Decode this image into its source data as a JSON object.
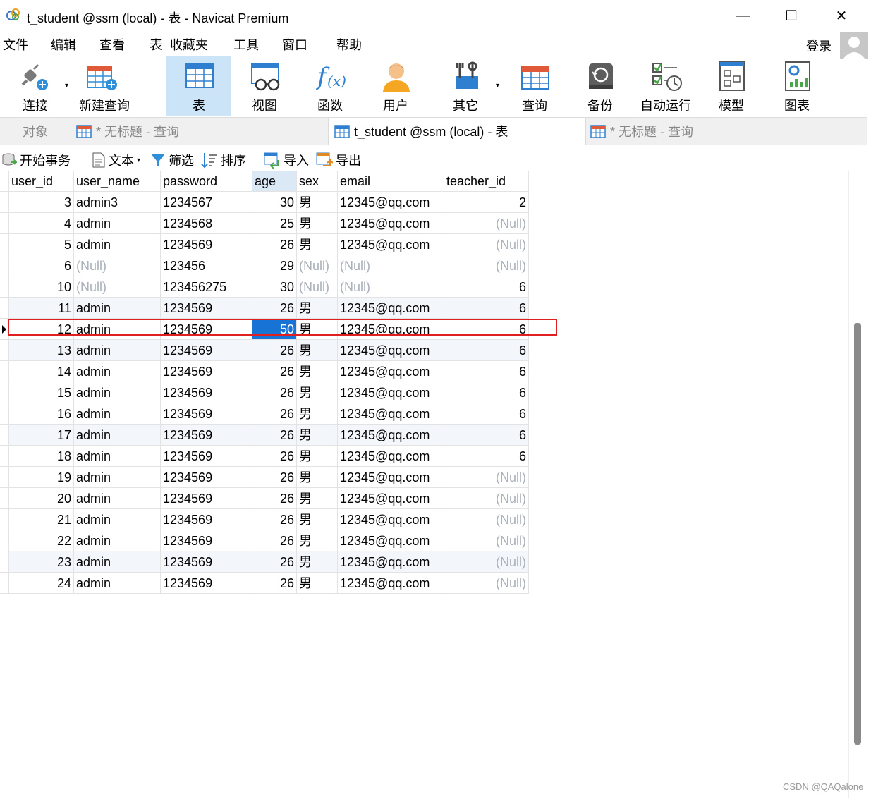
{
  "window": {
    "title": "t_student @ssm (local) - 表 - Navicat Premium",
    "minimize_glyph": "—",
    "maximize_glyph": "☐",
    "close_glyph": "✕"
  },
  "menu": {
    "items": [
      "文件",
      "编辑",
      "查看",
      "表",
      "收藏夹",
      "工具",
      "窗口",
      "帮助"
    ],
    "login": "登录"
  },
  "toolbar": {
    "buttons": [
      {
        "label": "连接",
        "icon": "plug-connect-icon"
      },
      {
        "label": "新建查询",
        "icon": "new-query-icon"
      },
      {
        "label": "表",
        "icon": "table-icon"
      },
      {
        "label": "视图",
        "icon": "view-glasses-icon"
      },
      {
        "label": "函数",
        "icon": "function-icon"
      },
      {
        "label": "用户",
        "icon": "user-icon"
      },
      {
        "label": "其它",
        "icon": "tools-icon"
      },
      {
        "label": "查询",
        "icon": "query-icon"
      },
      {
        "label": "备份",
        "icon": "backup-icon"
      },
      {
        "label": "自动运行",
        "icon": "auto-run-icon"
      },
      {
        "label": "模型",
        "icon": "model-icon"
      },
      {
        "label": "图表",
        "icon": "chart-icon"
      }
    ],
    "active": "表"
  },
  "tabs": [
    {
      "label": "对象"
    },
    {
      "label": "* 无标题 - 查询"
    },
    {
      "label": "t_student @ssm (local) - 表"
    },
    {
      "label": "* 无标题 - 查询"
    }
  ],
  "actions": {
    "begin_transaction": "开始事务",
    "text": "文本",
    "filter": "筛选",
    "sort": "排序",
    "import": "导入",
    "export": "导出"
  },
  "grid": {
    "columns": [
      "user_id",
      "user_name",
      "password",
      "age",
      "sex",
      "email",
      "teacher_id"
    ],
    "rows": [
      [
        "3",
        "admin3",
        "1234567",
        "30",
        "男",
        "12345@qq.com",
        "2"
      ],
      [
        "4",
        "admin",
        "1234568",
        "25",
        "男",
        "12345@qq.com",
        "(Null)"
      ],
      [
        "5",
        "admin",
        "1234569",
        "26",
        "男",
        "12345@qq.com",
        "(Null)"
      ],
      [
        "6",
        "(Null)",
        "123456",
        "29",
        "(Null)",
        "(Null)",
        "(Null)"
      ],
      [
        "10",
        "(Null)",
        "123456275",
        "30",
        "(Null)",
        "(Null)",
        "6"
      ],
      [
        "11",
        "admin",
        "1234569",
        "26",
        "男",
        "12345@qq.com",
        "6"
      ],
      [
        "12",
        "admin",
        "1234569",
        "50",
        "男",
        "12345@qq.com",
        "6"
      ],
      [
        "13",
        "admin",
        "1234569",
        "26",
        "男",
        "12345@qq.com",
        "6"
      ],
      [
        "14",
        "admin",
        "1234569",
        "26",
        "男",
        "12345@qq.com",
        "6"
      ],
      [
        "15",
        "admin",
        "1234569",
        "26",
        "男",
        "12345@qq.com",
        "6"
      ],
      [
        "16",
        "admin",
        "1234569",
        "26",
        "男",
        "12345@qq.com",
        "6"
      ],
      [
        "17",
        "admin",
        "1234569",
        "26",
        "男",
        "12345@qq.com",
        "6"
      ],
      [
        "18",
        "admin",
        "1234569",
        "26",
        "男",
        "12345@qq.com",
        "6"
      ],
      [
        "19",
        "admin",
        "1234569",
        "26",
        "男",
        "12345@qq.com",
        "(Null)"
      ],
      [
        "20",
        "admin",
        "1234569",
        "26",
        "男",
        "12345@qq.com",
        "(Null)"
      ],
      [
        "21",
        "admin",
        "1234569",
        "26",
        "男",
        "12345@qq.com",
        "(Null)"
      ],
      [
        "22",
        "admin",
        "1234569",
        "26",
        "男",
        "12345@qq.com",
        "(Null)"
      ],
      [
        "23",
        "admin",
        "1234569",
        "26",
        "男",
        "12345@qq.com",
        "(Null)"
      ],
      [
        "24",
        "admin",
        "1234569",
        "26",
        "男",
        "12345@qq.com",
        "(Null)"
      ]
    ],
    "selected_row": 6,
    "selected_column": "age"
  },
  "watermark": "CSDN @QAQalone"
}
